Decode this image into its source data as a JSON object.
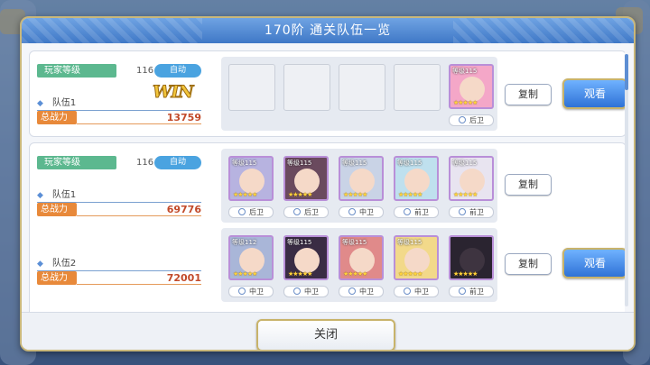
{
  "dialog": {
    "title": "170阶 通关队伍一览",
    "close_label": "关闭"
  },
  "labels": {
    "player_level": "玩家等级",
    "auto": "自动",
    "total_power": "总战力",
    "copy": "复制",
    "view": "观看",
    "win": "WIN"
  },
  "cards": [
    {
      "player_level": "116",
      "teams": [
        {
          "name": "队伍1",
          "power": "13759",
          "win": true,
          "members": [
            {
              "empty": true
            },
            {
              "empty": true
            },
            {
              "empty": true
            },
            {
              "empty": true
            },
            {
              "level": "等级115",
              "position": "后卫",
              "color": "#f4a7c8"
            }
          ]
        }
      ]
    },
    {
      "player_level": "116",
      "teams": [
        {
          "name": "队伍1",
          "power": "69776",
          "members": [
            {
              "level": "等级115",
              "position": "后卫",
              "color": "#b7b3e0"
            },
            {
              "level": "等级115",
              "position": "后卫",
              "color": "#6a4a5e"
            },
            {
              "level": "等级115",
              "position": "中卫",
              "color": "#c9d3e6"
            },
            {
              "level": "等级115",
              "position": "前卫",
              "color": "#bfe0ee"
            },
            {
              "level": "等级115",
              "position": "前卫",
              "color": "#e8e4f0"
            }
          ]
        },
        {
          "name": "队伍2",
          "power": "72001",
          "members": [
            {
              "level": "等级112",
              "position": "中卫",
              "color": "#a9b6d8"
            },
            {
              "level": "等级115",
              "position": "中卫",
              "color": "#3a2c44"
            },
            {
              "level": "等级115",
              "position": "中卫",
              "color": "#e08a8a"
            },
            {
              "level": "等级115",
              "position": "中卫",
              "color": "#f2d98a"
            },
            {
              "level": "",
              "position": "前卫",
              "color": "#2a2430"
            }
          ]
        }
      ]
    }
  ],
  "colors": {
    "accent": "#3f78c7",
    "power": "#e8893a",
    "level": "#5cb88f",
    "frame": "#c8b36a"
  }
}
